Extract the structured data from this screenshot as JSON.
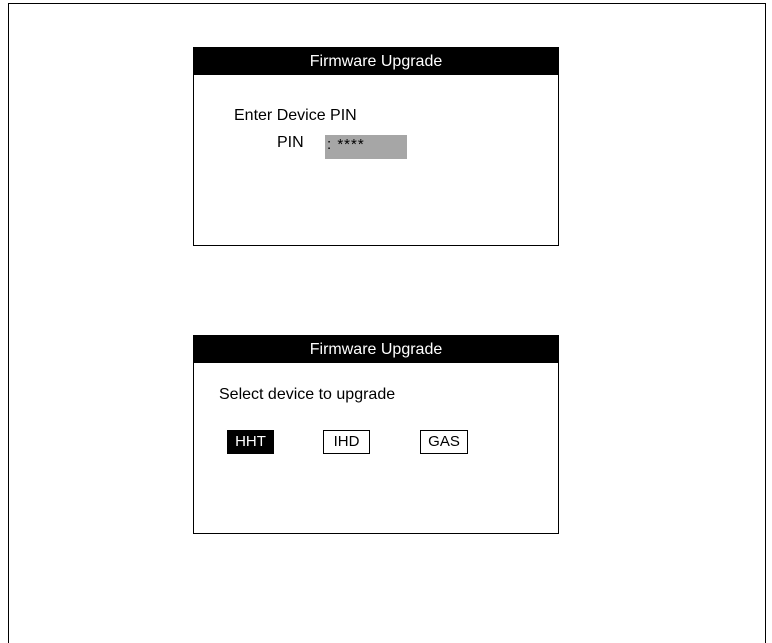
{
  "screen_pin": {
    "title": "Firmware Upgrade",
    "prompt": "Enter Device PIN",
    "pin_label": "PIN",
    "pin_value": ": ****"
  },
  "screen_select": {
    "title": "Firmware Upgrade",
    "prompt": "Select device to upgrade",
    "devices": [
      {
        "label": "HHT",
        "selected": true
      },
      {
        "label": "IHD",
        "selected": false
      },
      {
        "label": "GAS",
        "selected": false
      }
    ]
  },
  "colors": {
    "title_bar": "#000000",
    "pin_field": "#a6a6a6",
    "selected_button": "#000000"
  }
}
